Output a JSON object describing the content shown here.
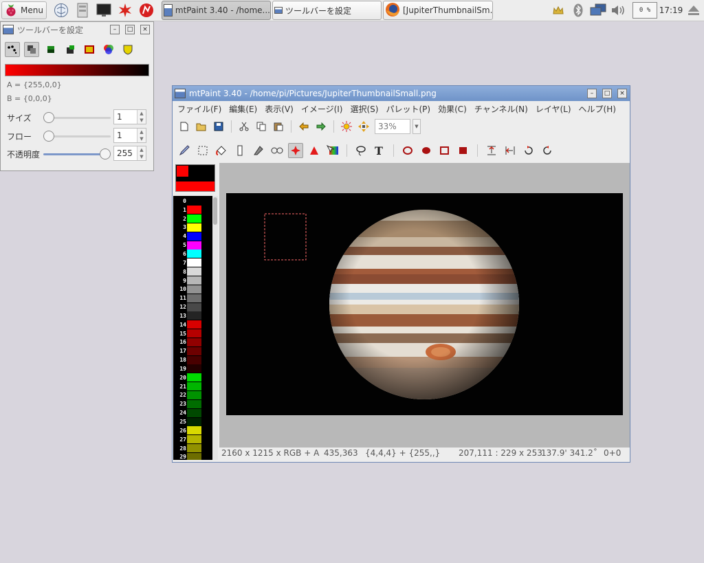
{
  "taskbar": {
    "menu_label": "Menu",
    "tasks": [
      {
        "label": "mtPaint 3.40 - /home...",
        "icon": "mtpaint-icon"
      },
      {
        "label": "ツールバーを設定",
        "icon": "window-icon"
      },
      {
        "label": "[JupiterThumbnailSm...",
        "icon": "firefox-icon"
      }
    ],
    "cpu": "0 %",
    "clock": "17:19"
  },
  "toolbar_settings": {
    "title": "ツールバーを設定",
    "color_a": "A = {255,0,0}",
    "color_b": "B = {0,0,0}",
    "size_label": "サイズ",
    "size_value": "1",
    "flow_label": "フロー",
    "flow_value": "1",
    "opacity_label": "不透明度",
    "opacity_value": "255",
    "opacity_fraction": 1.0
  },
  "main_window": {
    "title": "mtPaint 3.40 - /home/pi/Pictures/JupiterThumbnailSmall.png",
    "menu": [
      "ファイル(F)",
      "編集(E)",
      "表示(V)",
      "イメージ(I)",
      "選択(S)",
      "パレット(P)",
      "効果(C)",
      "チャンネル(N)",
      "レイヤ(L)",
      "ヘルプ(H)"
    ],
    "zoom": "33%",
    "status": {
      "image_info": "2160 x 1215 x RGB + A",
      "cursor": "435,363",
      "pixel": "{4,4,4} + {255,,}",
      "selection": "207,111 : 229 x 253",
      "angle": "137.9' 341.2˚",
      "offset": "0+0"
    }
  },
  "palette": [
    {
      "index": "0",
      "color": "#000000"
    },
    {
      "index": "1",
      "color": "#ff0000"
    },
    {
      "index": "2",
      "color": "#00ff00"
    },
    {
      "index": "3",
      "color": "#ffff00"
    },
    {
      "index": "4",
      "color": "#0000ff"
    },
    {
      "index": "5",
      "color": "#ff00ff"
    },
    {
      "index": "6",
      "color": "#00ffff"
    },
    {
      "index": "7",
      "color": "#ffffff"
    },
    {
      "index": "8",
      "color": "#d9d9d9"
    },
    {
      "index": "9",
      "color": "#b6b6b6"
    },
    {
      "index": "10",
      "color": "#929292"
    },
    {
      "index": "11",
      "color": "#6d6d6d"
    },
    {
      "index": "12",
      "color": "#494949"
    },
    {
      "index": "13",
      "color": "#242424"
    },
    {
      "index": "14",
      "color": "#d90000"
    },
    {
      "index": "15",
      "color": "#b60000"
    },
    {
      "index": "16",
      "color": "#920000"
    },
    {
      "index": "17",
      "color": "#6d0000"
    },
    {
      "index": "18",
      "color": "#490000"
    },
    {
      "index": "19",
      "color": "#240000"
    },
    {
      "index": "20",
      "color": "#00d900"
    },
    {
      "index": "21",
      "color": "#00b600"
    },
    {
      "index": "22",
      "color": "#009200"
    },
    {
      "index": "23",
      "color": "#006d00"
    },
    {
      "index": "24",
      "color": "#004900"
    },
    {
      "index": "25",
      "color": "#002400"
    },
    {
      "index": "26",
      "color": "#d9d900"
    },
    {
      "index": "27",
      "color": "#b6b600"
    },
    {
      "index": "28",
      "color": "#929200"
    },
    {
      "index": "29",
      "color": "#6d6d00"
    }
  ],
  "colors": {
    "titlebar": "#7ea0d0",
    "canvas_bg": "#b8b8b8",
    "image_bg": "#020202",
    "accent_red": "#ff0000"
  }
}
